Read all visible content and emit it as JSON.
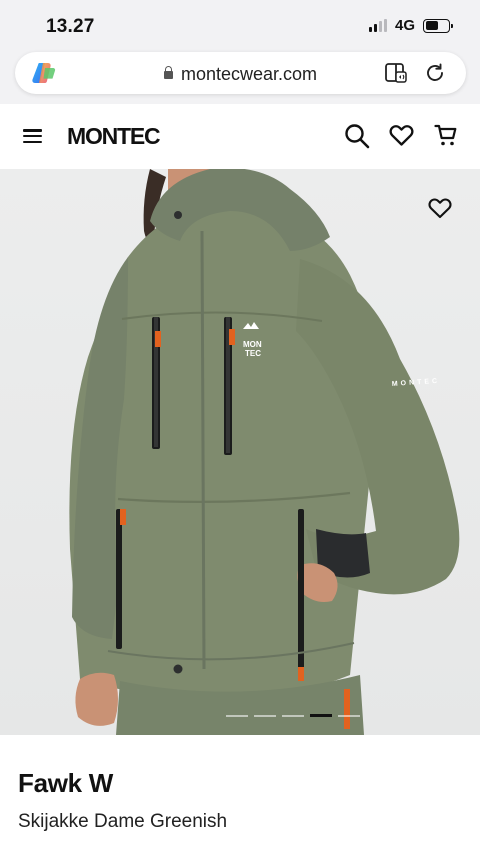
{
  "status": {
    "time": "13.27",
    "network": "4G",
    "battery_level": 0.55
  },
  "browser": {
    "url": "montecwear.com"
  },
  "header": {
    "logo": "MONTEC"
  },
  "hero": {
    "jacket_logo": "MON TEC",
    "sleeve_text": "MONTEC",
    "slide_count": 5,
    "active_slide": 4
  },
  "product": {
    "name": "Fawk W",
    "subtitle": "Skijakke Dame Greenish"
  },
  "colors": {
    "jacket": "#7f8b6e",
    "accent_orange": "#e2621f",
    "background": "#e8e9e9"
  }
}
